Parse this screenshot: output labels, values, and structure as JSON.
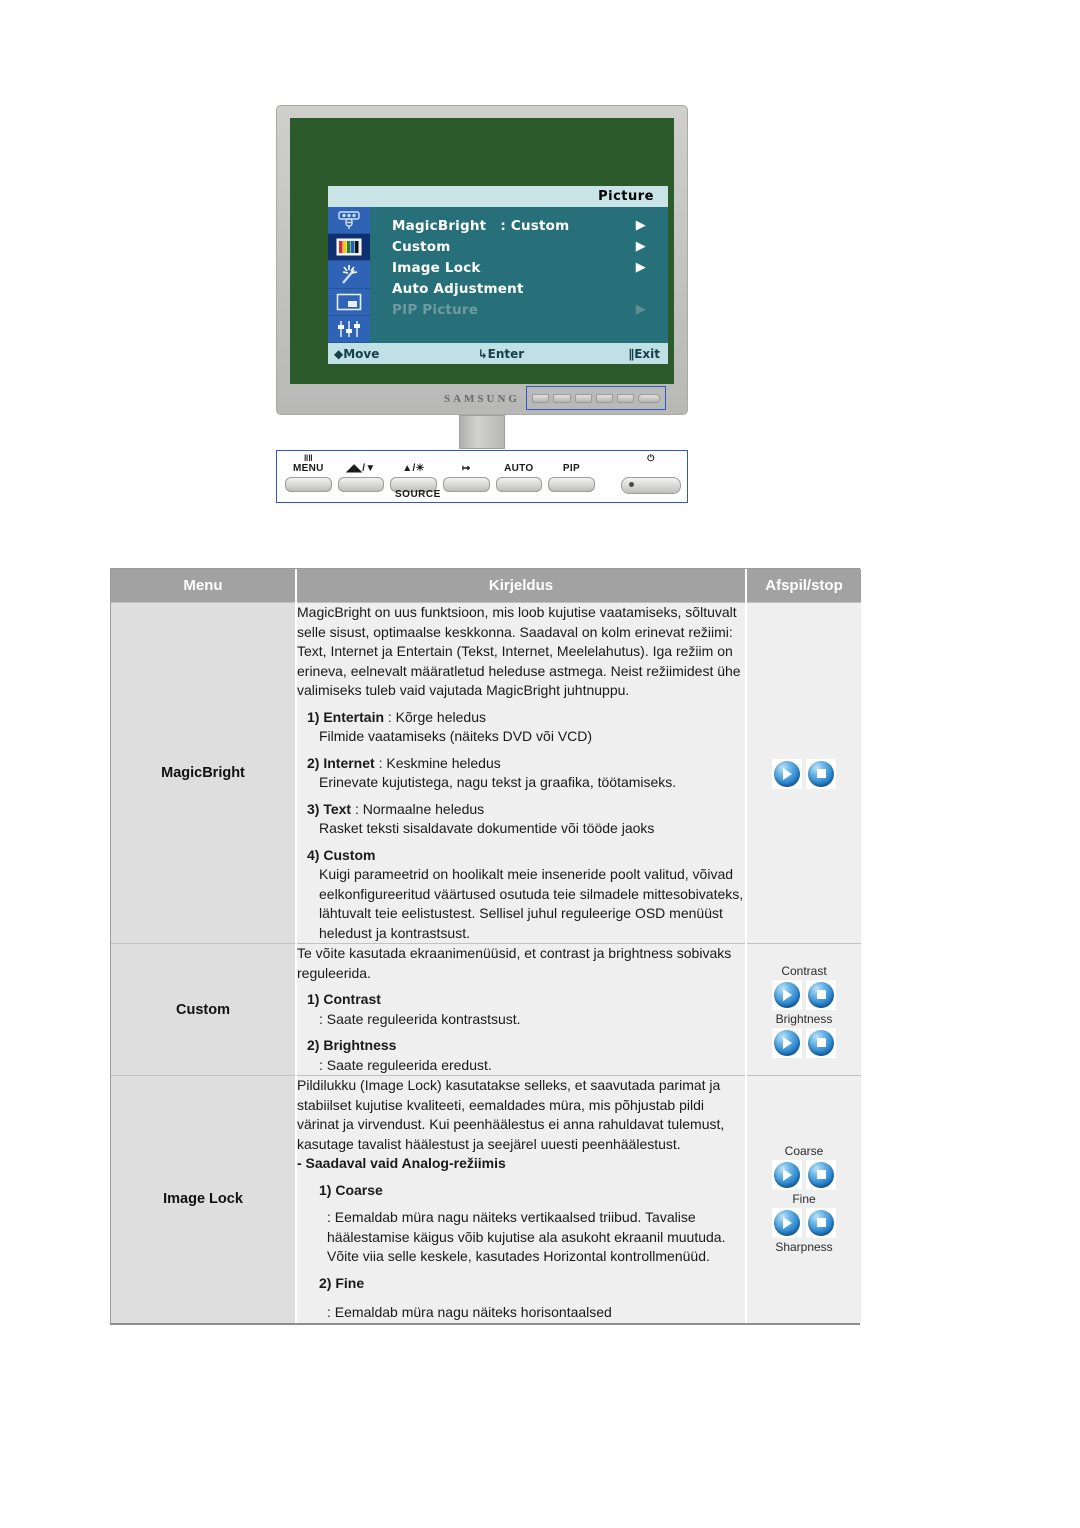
{
  "illustration": {
    "brand": "SAMSUNG",
    "osd": {
      "title": "Picture",
      "items": [
        {
          "label": "MagicBright",
          "value": ": Custom",
          "arrow": "▶",
          "dim": false
        },
        {
          "label": "Custom",
          "value": "",
          "arrow": "▶",
          "dim": false
        },
        {
          "label": "Image Lock",
          "value": "",
          "arrow": "▶",
          "dim": false
        },
        {
          "label": "Auto Adjustment",
          "value": "",
          "arrow": "",
          "dim": false
        },
        {
          "label": "PIP Picture",
          "value": "",
          "arrow": "▶",
          "dim": true
        }
      ],
      "footer": {
        "move": "Move",
        "enter": "Enter",
        "exit": "Exit"
      },
      "sidebar_icons": [
        "osd-input-icon",
        "osd-picture-icon",
        "osd-magic-icon",
        "osd-pip-icon",
        "osd-setup-icon"
      ]
    },
    "controls": [
      {
        "glyph": "‖‖",
        "cap": "MENU",
        "name": "menu-button"
      },
      {
        "glyph": "",
        "cap": "◢◣/▼",
        "name": "down-button"
      },
      {
        "glyph": "",
        "cap": "▲/☀",
        "name": "up-brightness-button"
      },
      {
        "glyph": "",
        "cap": "↦",
        "name": "enter-button"
      },
      {
        "glyph": "",
        "cap": "AUTO",
        "name": "auto-button"
      },
      {
        "glyph": "",
        "cap": "PIP",
        "name": "pip-button"
      }
    ],
    "power_label": "⏻",
    "source_label": "SOURCE"
  },
  "table": {
    "headers": [
      "Menu",
      "Kirjeldus",
      "Afspil/stop"
    ],
    "rows": [
      {
        "menu": "MagicBright",
        "intro": "MagicBright on uus funktsioon, mis loob kujutise vaatamiseks, sõltuvalt selle sisust, optimaalse keskkonna. Saadaval on kolm erinevat režiimi: Text, Internet ja Entertain (Tekst, Internet, Meelelahutus). Iga režiim on erineva, eelnevalt määratletud heleduse astmega. Neist režiimidest ühe valimiseks tuleb vaid vajutada MagicBright juhtnuppu.",
        "items": [
          {
            "head": "1) Entertain",
            "rest": " : Kõrge heledus",
            "sub": "Filmide vaatamiseks (näiteks DVD või VCD)"
          },
          {
            "head": "2) Internet",
            "rest": " : Keskmine heledus",
            "sub": "Erinevate kujutistega, nagu tekst ja graafika, töötamiseks."
          },
          {
            "head": "3) Text",
            "rest": " : Normaalne heledus",
            "sub": "Rasket teksti sisaldavate dokumentide või tööde jaoks"
          },
          {
            "head": "4) Custom",
            "rest": "",
            "sub": "Kuigi parameetrid on hoolikalt meie inseneride poolt valitud, võivad eelkonfigureeritud väärtused osutuda teie silmadele mittesobivateks, lähtuvalt teie eelistustest. Sellisel juhul reguleerige OSD menüüst heledust ja kontrastsust."
          }
        ],
        "buttons": [
          {
            "caption": "",
            "play": "play-icon",
            "stop": "stop-icon"
          }
        ]
      },
      {
        "menu": "Custom",
        "intro": "Te võite kasutada ekraanimenüüsid, et contrast ja brightness sobivaks reguleerida.",
        "items": [
          {
            "head": "1) Contrast",
            "rest": "",
            "sub": ": Saate reguleerida kontrastsust."
          },
          {
            "head": "2) Brightness",
            "rest": "",
            "sub": ": Saate reguleerida eredust."
          }
        ],
        "buttons": [
          {
            "caption": "Contrast",
            "play": "play-icon",
            "stop": "stop-icon"
          },
          {
            "caption": "Brightness",
            "play": "play-icon",
            "stop": "stop-icon"
          }
        ]
      },
      {
        "menu": "Image Lock",
        "intro": "Pildilukku (Image Lock) kasutatakse selleks, et saavutada parimat ja stabiilset kujutise kvaliteeti, eemaldades müra, mis põhjustab pildi värinat ja virvendust. Kui peenhäälestus ei anna rahuldavat tulemust, kasutage tavalist häälestust ja seejärel uuesti peenhäälestust.",
        "note": "- Saadaval vaid Analog-režiimis",
        "items": [
          {
            "head": "1) Coarse",
            "rest": "",
            "sub": ": Eemaldab müra nagu näiteks vertikaalsed triibud. Tavalise häälestamise käigus võib kujutise ala asukoht ekraanil muutuda. Võite viia selle keskele, kasutades Horizontal kontrollmenüüd."
          },
          {
            "head": "2) Fine",
            "rest": "",
            "sub": ": Eemaldab müra nagu näiteks horisontaalsed"
          }
        ],
        "buttons": [
          {
            "caption": "Coarse",
            "play": "play-icon",
            "stop": "stop-icon"
          },
          {
            "caption": "Fine",
            "play": "play-icon",
            "stop": "stop-icon"
          }
        ],
        "trailing_caption": "Sharpness"
      }
    ]
  },
  "colors": {
    "header_bg": "#a2a2a6",
    "menu_cell_bg": "#dedede",
    "desc_cell_bg": "#efefef",
    "osd_bg": "#27707a",
    "osd_title_bg": "#c8e4e6",
    "osd_icon_bg": "#2f63b5",
    "button_blue": "#2b85cf",
    "highlight_border": "#3355cc"
  }
}
